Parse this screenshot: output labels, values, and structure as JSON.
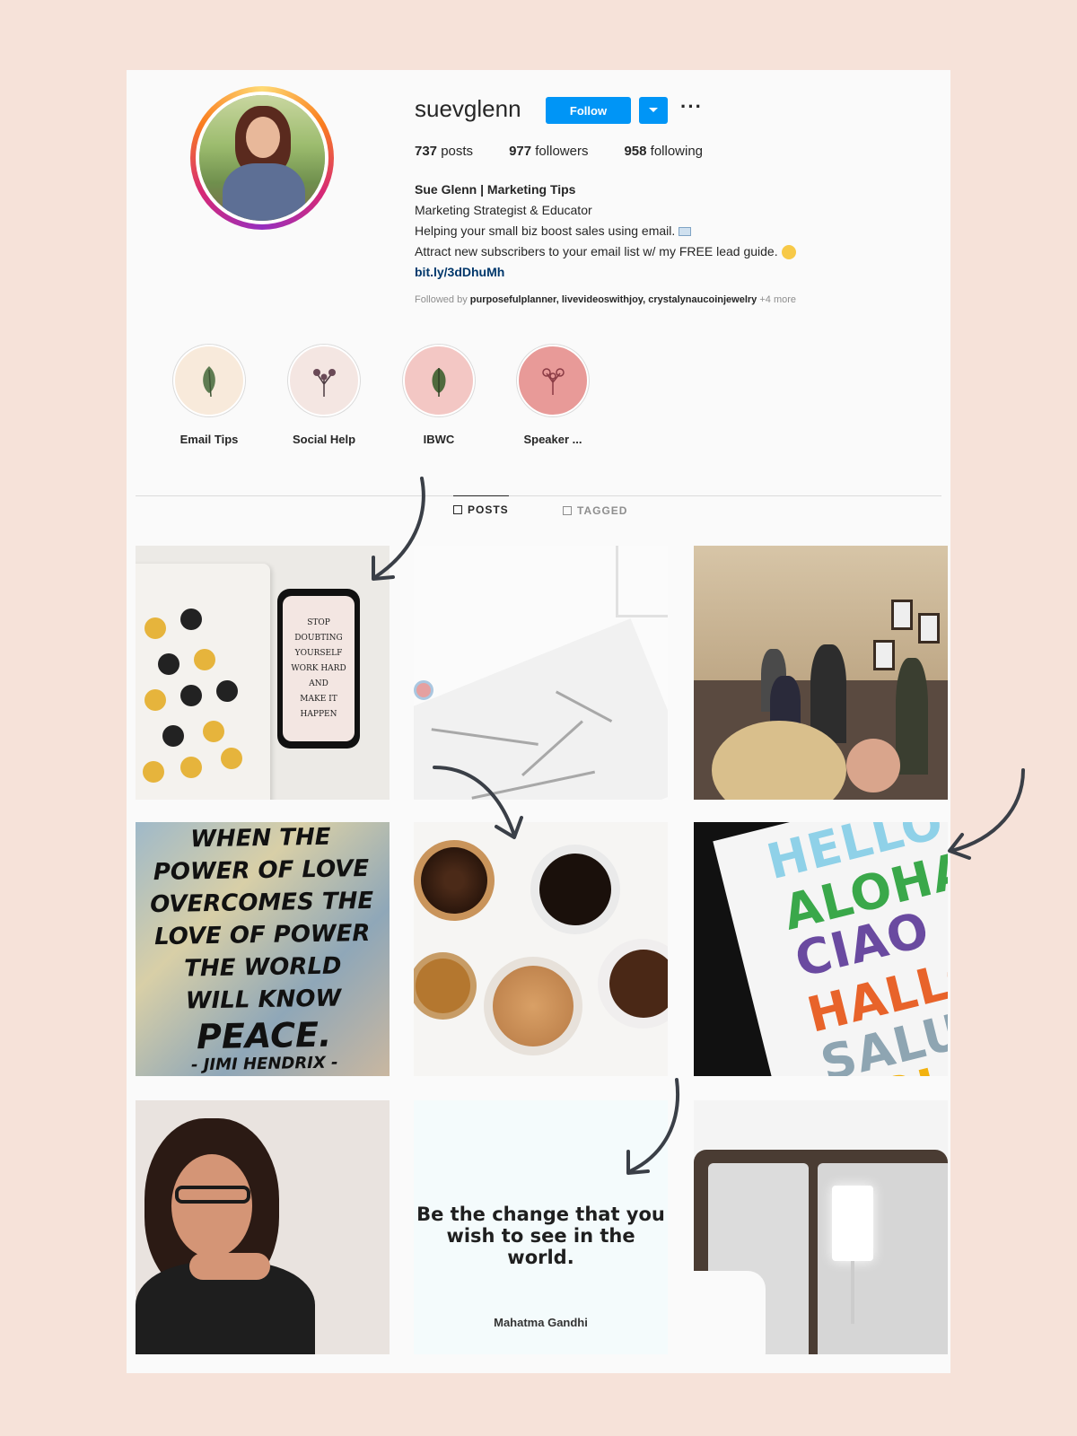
{
  "profile": {
    "username": "suevglenn",
    "follow_label": "Follow",
    "more_label": "···",
    "stats": [
      {
        "count": "737",
        "label": "posts"
      },
      {
        "count": "977",
        "label": "followers"
      },
      {
        "count": "958",
        "label": "following"
      }
    ],
    "bio": {
      "name": "Sue Glenn | Marketing Tips",
      "line1": "Marketing Strategist & Educator",
      "line2": "Helping your small biz boost sales using email.",
      "line3": "Attract new subscribers to your email list w/ my FREE lead guide.",
      "link": "bit.ly/3dDhuMh"
    },
    "followed_by_prefix": "Followed by",
    "followed_by_users": "purposefulplanner, livevideoswithjoy, crystalynaucoinjewelry",
    "followed_by_more": "+4 more"
  },
  "highlights": [
    {
      "label": "Email Tips",
      "color": "#f8eadb",
      "icon": "leaf-icon"
    },
    {
      "label": "Social Help",
      "color": "#f4e6e2",
      "icon": "flower-icon"
    },
    {
      "label": "IBWC",
      "color": "#f3c7c4",
      "icon": "leaf-icon"
    },
    {
      "label": "Speaker ...",
      "color": "#e89a98",
      "icon": "flower-icon"
    }
  ],
  "tabs": {
    "posts": "POSTS",
    "tagged": "TAGGED"
  },
  "posts": {
    "phone_text": [
      "STOP DOUBTING",
      "YOURSELF",
      "WORK HARD AND",
      "MAKE IT HAPPEN"
    ],
    "quote_lines": [
      "WHEN THE",
      "POWER OF LOVE",
      "OVERCOMES THE",
      "LOVE OF POWER",
      "THE WORLD",
      "WILL KNOW",
      "PEACE.",
      "- JIMI HENDRIX -"
    ],
    "hello_words": [
      "HELLO",
      "ALOHA",
      "CIAO",
      "HALLO",
      "SALUT",
      "HOLA"
    ],
    "gandhi_quote_1": "Be the change that you",
    "gandhi_quote_2": "wish to see in the world.",
    "gandhi_author": "Mahatma Gandhi"
  },
  "colors": {
    "background": "#f6e2d9",
    "follow_button": "#0095f6",
    "link": "#00376b",
    "arrow": "#3a3f47"
  }
}
